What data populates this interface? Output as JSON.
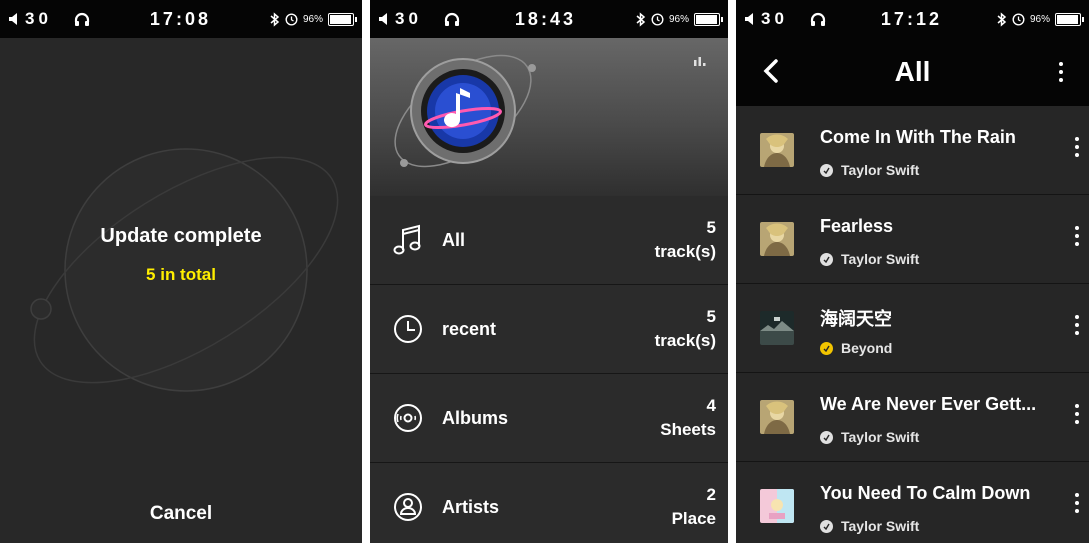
{
  "status_bars": [
    {
      "volume": "30",
      "time": "17:08",
      "battery": "96%",
      "battery_level": 0.96
    },
    {
      "volume": "30",
      "time": "18:43",
      "battery": "96%",
      "battery_level": 0.96
    },
    {
      "volume": "30",
      "time": "17:12",
      "battery": "96%",
      "battery_level": 0.96
    }
  ],
  "update_screen": {
    "title": "Update complete",
    "count_text": "5 in total",
    "cancel_label": "Cancel"
  },
  "library_screen": {
    "items": [
      {
        "label": "All",
        "count": "5",
        "unit": "track(s)",
        "icon": "music-note-icon"
      },
      {
        "label": "recent",
        "count": "5",
        "unit": "track(s)",
        "icon": "clock-icon"
      },
      {
        "label": "Albums",
        "count": "4",
        "unit": "Sheets",
        "icon": "disc-icon"
      },
      {
        "label": "Artists",
        "count": "2",
        "unit": "Place",
        "icon": "person-icon"
      }
    ]
  },
  "tracks_screen": {
    "title": "All",
    "tracks": [
      {
        "title": "Come In With The Rain",
        "artist": "Taylor Swift"
      },
      {
        "title": "Fearless",
        "artist": "Taylor Swift"
      },
      {
        "title": "海阔天空",
        "artist": "Beyond"
      },
      {
        "title": "We Are Never Ever Gett...",
        "artist": "Taylor Swift"
      },
      {
        "title": "You Need To Calm Down",
        "artist": "Taylor Swift"
      }
    ]
  },
  "colors": {
    "background": "#282828",
    "status_bar": "#050505",
    "accent_yellow": "#ffee00",
    "text": "#ffffff"
  }
}
